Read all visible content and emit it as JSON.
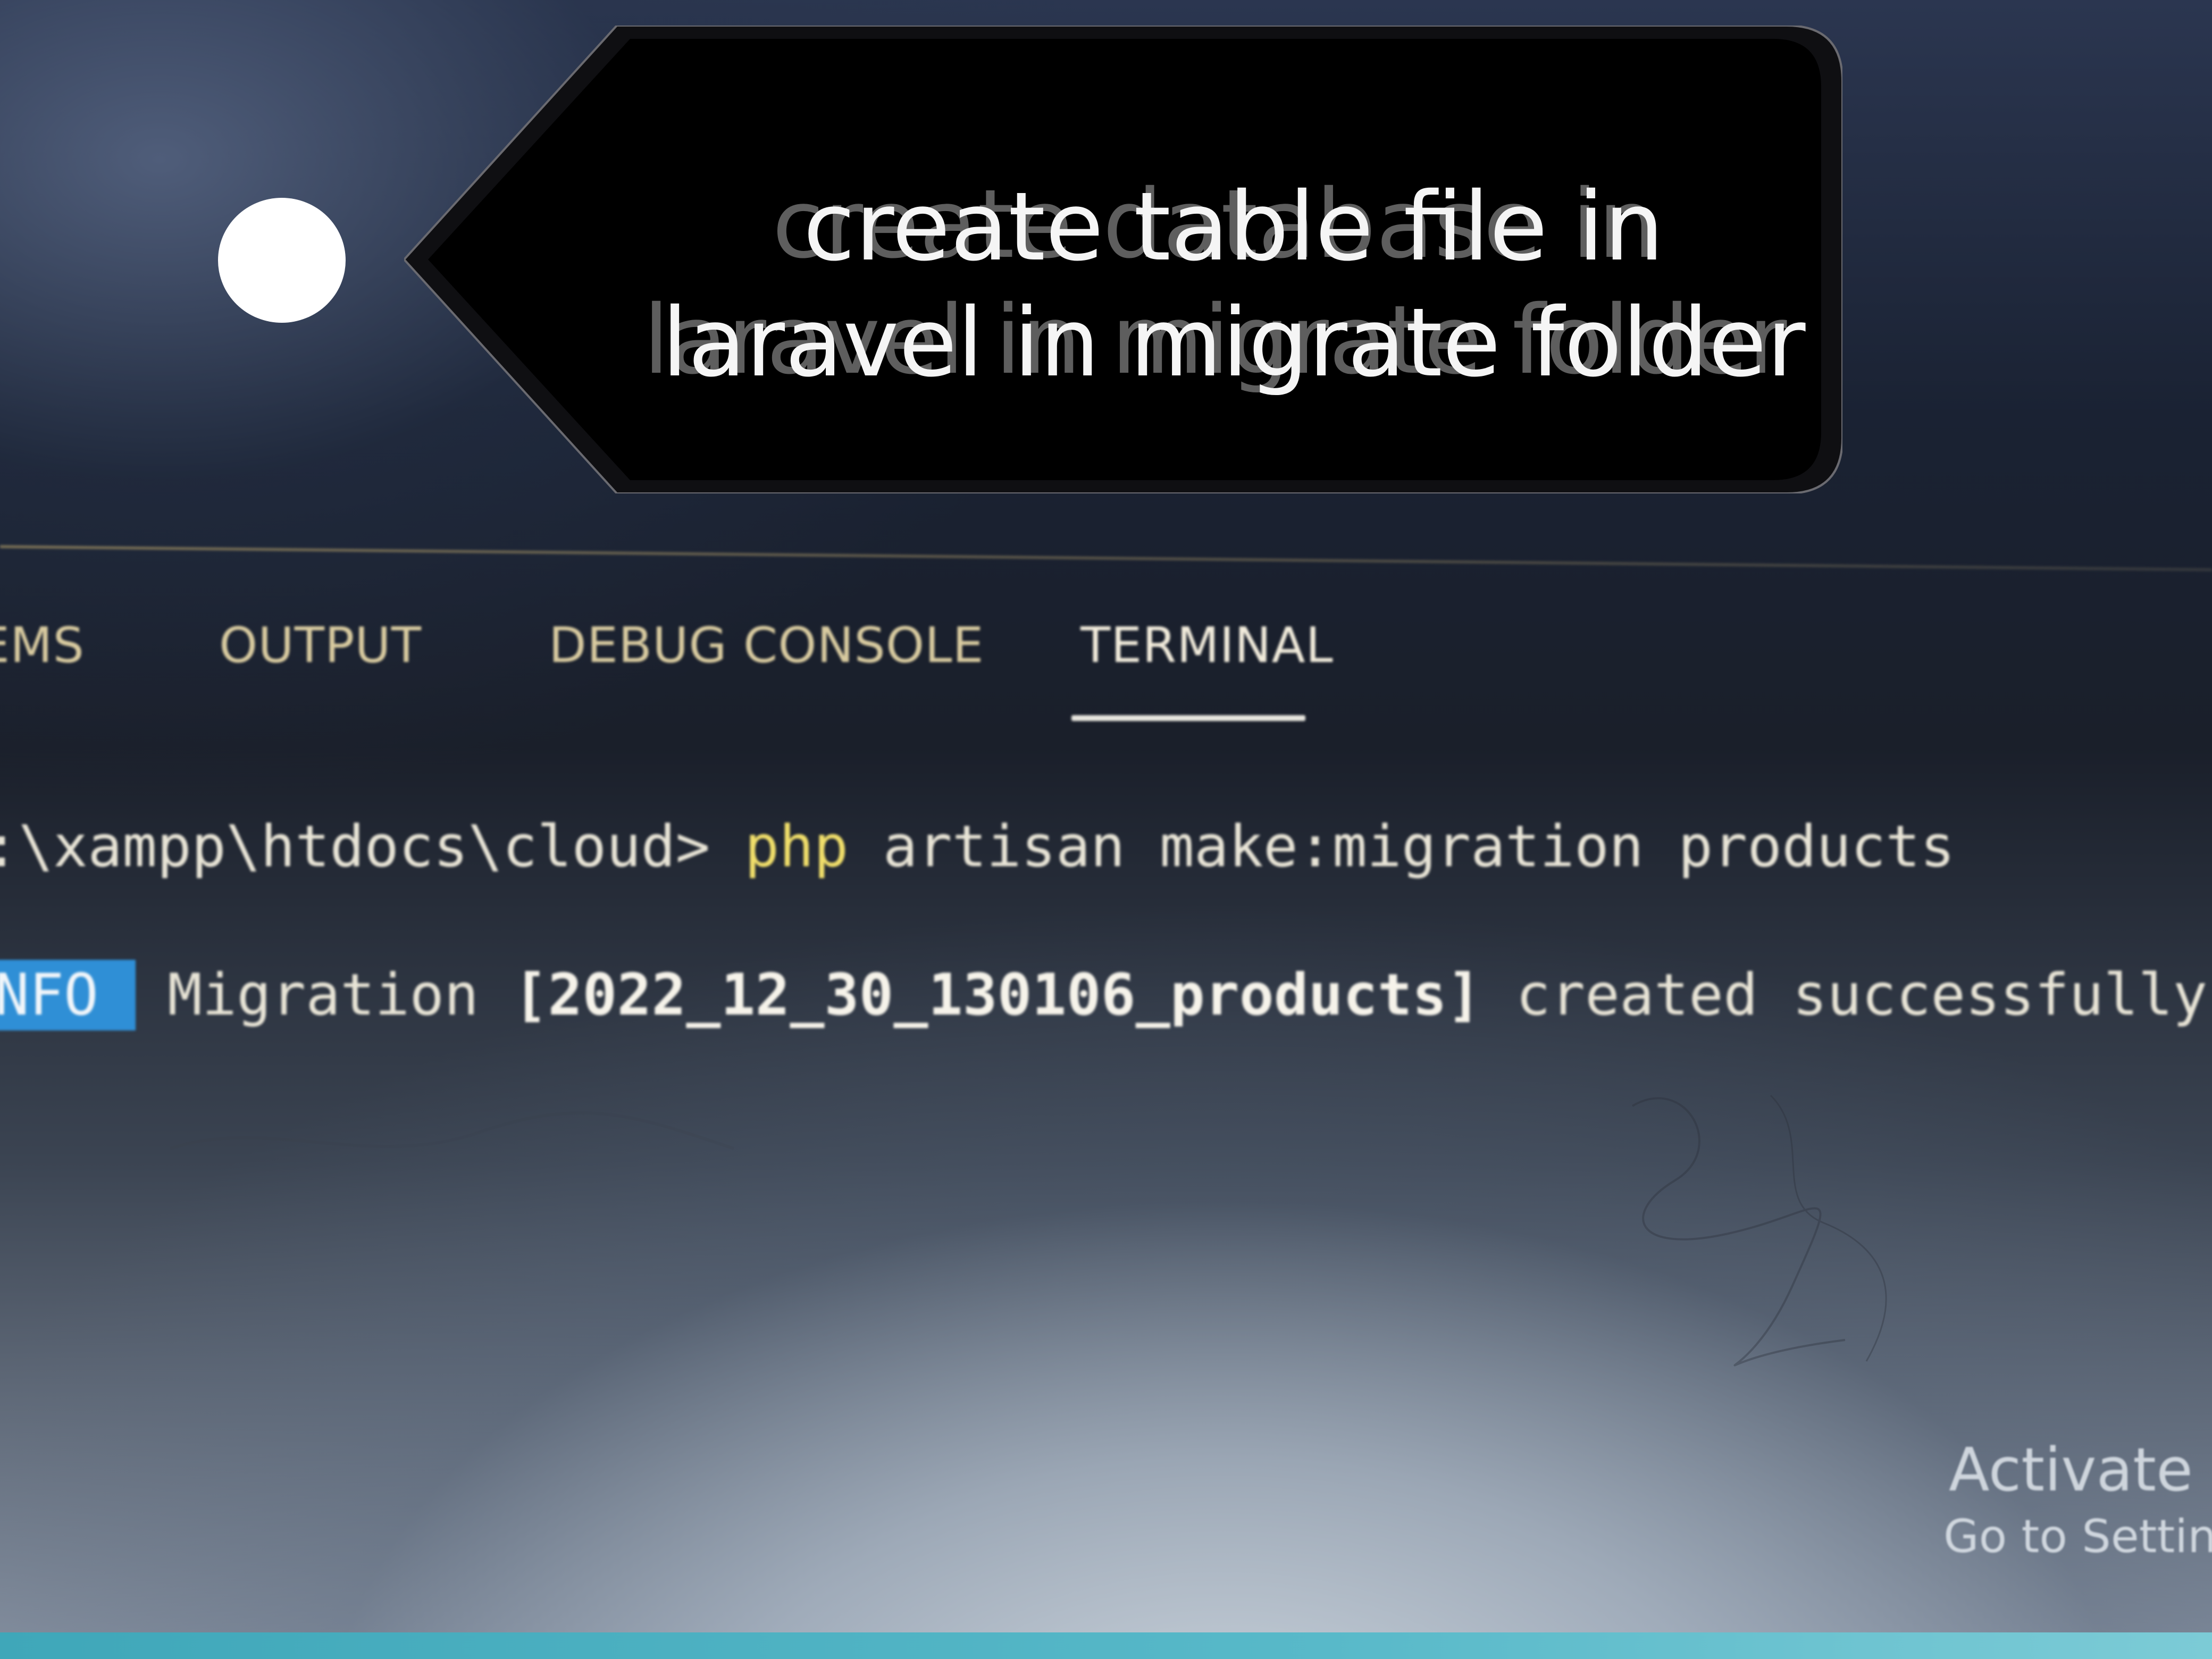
{
  "annotation": {
    "text": "create table file in\nlaravel in migrate folder",
    "ghost_text": "create database in\nlaravel in migrate folder"
  },
  "panel": {
    "tabs": [
      {
        "label": "EMS",
        "active": false
      },
      {
        "label": "OUTPUT",
        "active": false
      },
      {
        "label": "DEBUG CONSOLE",
        "active": false
      },
      {
        "label": "TERMINAL",
        "active": true
      }
    ]
  },
  "terminal": {
    "prompt": ":\\xampp\\htdocs\\cloud>",
    "command_keyword": "php",
    "command_rest": "artisan make:migration products",
    "info_label": "NFO",
    "info_prefix": "Migration",
    "migration_name": "[2022_12_30_130106_products]",
    "info_suffix": "created successfully."
  },
  "watermark": {
    "title": "Activate W",
    "subtitle": "Go to Setting"
  },
  "colors": {
    "accent_tab_underline": "#e8e6df",
    "info_badge": "#2f8fd6",
    "php_keyword": "#f0de6a",
    "tab_text": "#d9cba0",
    "callout_background": "#000000"
  }
}
